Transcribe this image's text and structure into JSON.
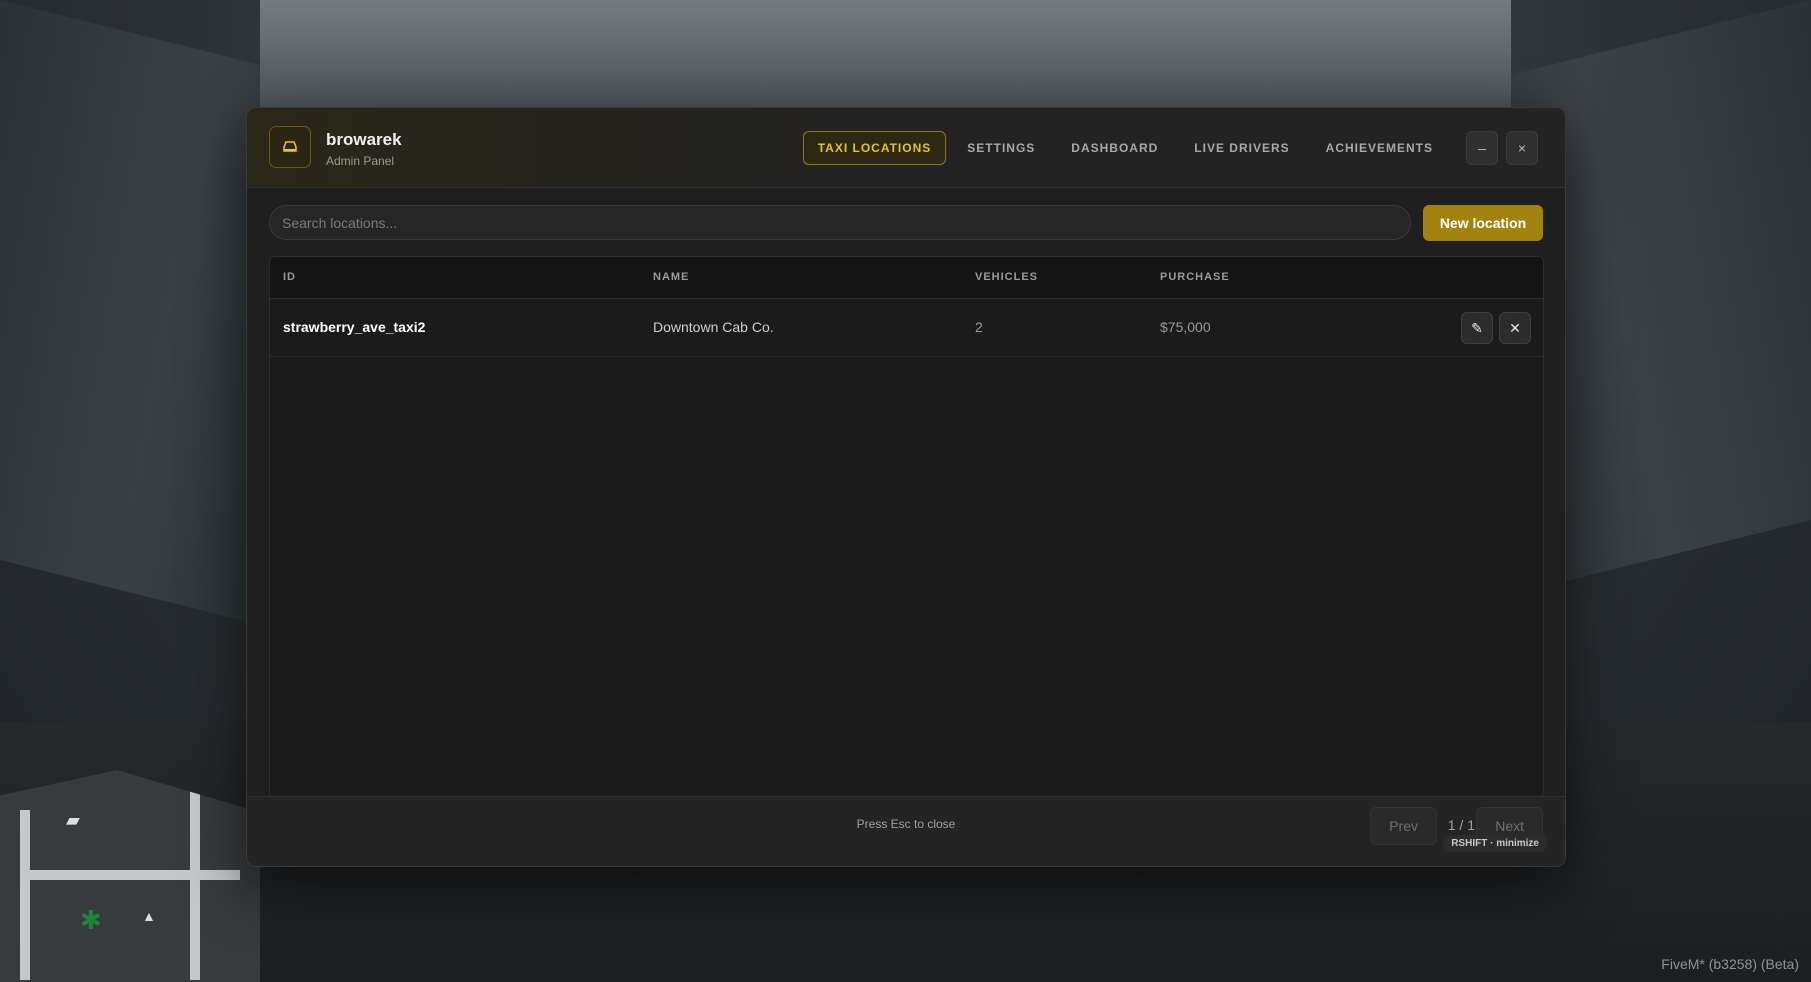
{
  "app": {
    "name": "browarek",
    "subtitle": "Admin Panel"
  },
  "tabs": [
    {
      "label": "TAXI LOCATIONS",
      "active": true
    },
    {
      "label": "SETTINGS",
      "active": false
    },
    {
      "label": "DASHBOARD",
      "active": false
    },
    {
      "label": "LIVE DRIVERS",
      "active": false
    },
    {
      "label": "ACHIEVEMENTS",
      "active": false
    }
  ],
  "window_controls": {
    "minimize": "–",
    "close": "×"
  },
  "toolbar": {
    "search_placeholder": "Search locations...",
    "new_button": "New location"
  },
  "table": {
    "columns": [
      "ID",
      "NAME",
      "VEHICLES",
      "PURCHASE"
    ],
    "rows": [
      {
        "id": "strawberry_ave_taxi2",
        "name": "Downtown Cab Co.",
        "vehicles": "2",
        "purchase": "$75,000"
      }
    ]
  },
  "footer": {
    "hint": "Press Esc to close",
    "prev": "Prev",
    "page": "1 / 1",
    "next": "Next",
    "minimize_hint": "RSHIFT · minimize"
  },
  "watermark": "FiveM* (b3258) (Beta)",
  "colors": {
    "accent": "#a3820f",
    "accent_text": "#e8c230",
    "panel_bg": "#1f1f1f"
  },
  "icons": {
    "brand": "taxi-icon",
    "edit": "pencil-icon",
    "delete": "close-icon"
  }
}
